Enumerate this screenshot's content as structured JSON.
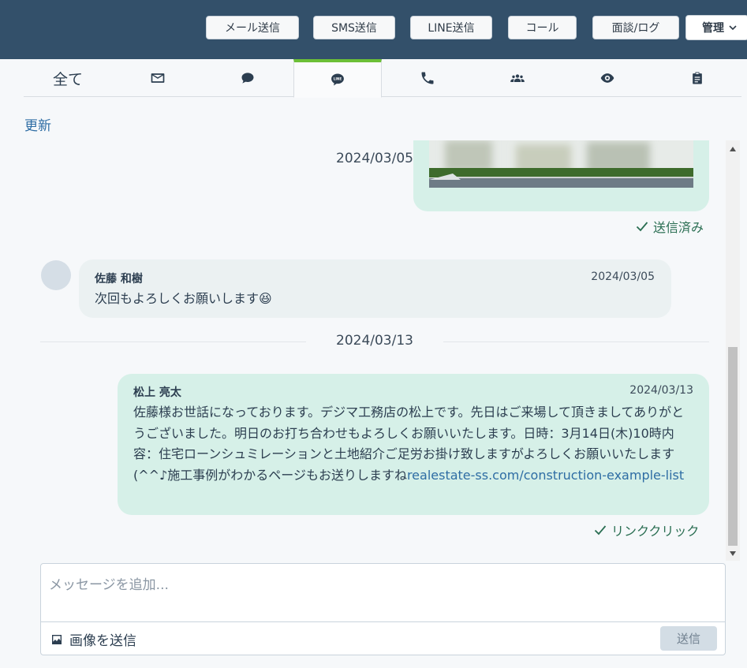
{
  "header": {
    "buttons": [
      "メール送信",
      "SMS送信",
      "LINE送信",
      "コール",
      "面談/ログ"
    ],
    "admin_label": "管理"
  },
  "tabs": {
    "all_label": "全て",
    "icons": [
      "mail-icon",
      "chat-bubble-icon",
      "line-icon",
      "phone-icon",
      "group-icon",
      "eye-icon",
      "clipboard-icon"
    ],
    "active": "line-icon"
  },
  "refresh_label": "更新",
  "messages": {
    "date_1": "2024/03/05",
    "image_status": "送信済み",
    "incoming": {
      "sender": "佐藤 和樹",
      "date": "2024/03/05",
      "text": "次回もよろしくお願いします😆"
    },
    "date_2": "2024/03/13",
    "outgoing": {
      "sender": "松上 亮太",
      "date": "2024/03/13",
      "text": "佐藤様お世話になっております。デジマ工務店の松上です。先日はご来場して頂きましてありがとうございました。明日のお打ち合わせもよろしくお願いいたします。日時：3月14日(木)10時内容：住宅ローンシュミレーションと土地紹介ご足労お掛け致しますがよろしくお願いいたします(^^♪施工事例がわかるページもお送りしますね",
      "link": "realestate-ss.com/construction-example-list",
      "status": "リンククリック"
    }
  },
  "composer": {
    "placeholder": "メッセージを追加...",
    "attach_label": "画像を送信",
    "send_label": "送信"
  }
}
